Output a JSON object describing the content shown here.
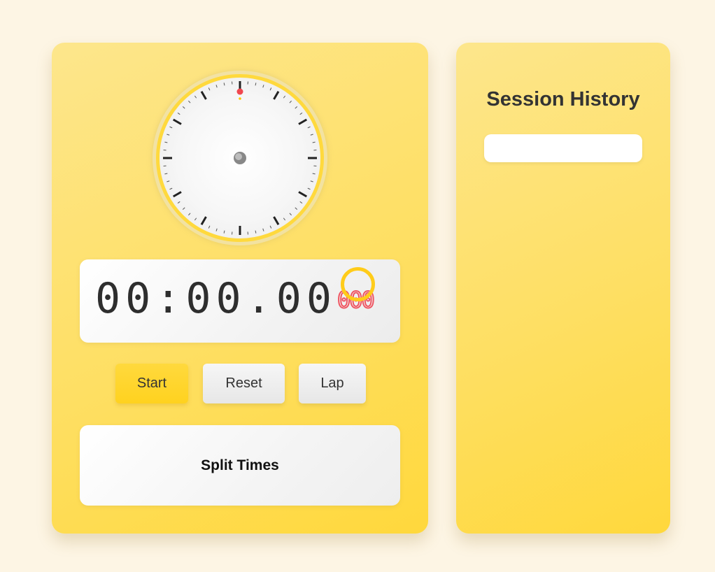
{
  "timer": {
    "main": "00:00.00",
    "ms": "000"
  },
  "controls": {
    "start_label": "Start",
    "reset_label": "Reset",
    "lap_label": "Lap"
  },
  "splits": {
    "title": "Split Times"
  },
  "history": {
    "title": "Session History"
  },
  "icons": {
    "dial": "stopwatch-dial-icon",
    "cursor": "cursor-ring-icon"
  },
  "colors": {
    "accent": "#ffd93d",
    "ms_digits": "#ef5561",
    "hand_marker": "#f0474e",
    "background": "#fdf5e4"
  }
}
